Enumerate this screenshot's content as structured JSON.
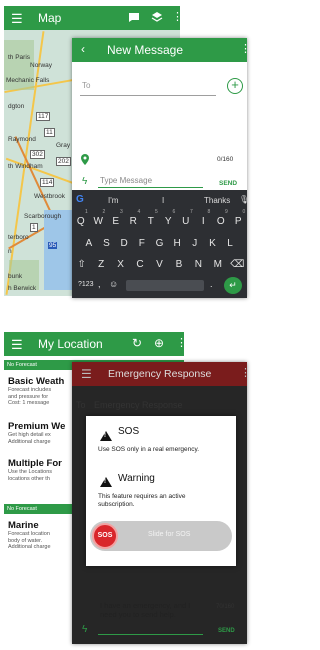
{
  "screen1": {
    "map_title": "Map",
    "map_labels": [
      "th Paris",
      "Norway",
      "Mechanic Falls",
      "dgton",
      "Raymond",
      "Gray",
      "th Windham",
      "Westbrook",
      "Scarborough",
      "terboro",
      "n",
      "bunk",
      "h Berwick"
    ],
    "road_numbers": [
      "117",
      "11",
      "302",
      "202",
      "114",
      "1",
      "95"
    ],
    "message": {
      "title": "New Message",
      "to_placeholder": "To",
      "counter": "0/160",
      "input_placeholder": "Type Message",
      "send_label": "SEND"
    },
    "keyboard": {
      "suggestions": [
        "I'm",
        "I",
        "Thanks"
      ],
      "row1": [
        "Q",
        "W",
        "E",
        "R",
        "T",
        "Y",
        "U",
        "I",
        "O",
        "P"
      ],
      "row1_hints": [
        "1",
        "2",
        "3",
        "4",
        "5",
        "6",
        "7",
        "8",
        "9",
        "0"
      ],
      "row2": [
        "A",
        "S",
        "D",
        "F",
        "G",
        "H",
        "J",
        "K",
        "L"
      ],
      "row3": [
        "Z",
        "X",
        "C",
        "V",
        "B",
        "N",
        "M"
      ],
      "sym_label": "?123",
      "comma": ",",
      "period": "."
    }
  },
  "screen2": {
    "title": "My Location",
    "section_no_forecast": "No Forecast",
    "items": [
      {
        "title": "Basic Weath",
        "desc": [
          "Forecast includes",
          "and pressure for",
          "Cost: 1 message"
        ]
      },
      {
        "title": "Premium We",
        "desc": [
          "Get high detail ex",
          "Additional charge"
        ]
      },
      {
        "title": "Multiple For",
        "desc": [
          "Use the Locations",
          "locations other th"
        ]
      }
    ],
    "section_no_forecast_2": "No Forecast",
    "marine": {
      "title": "Marine",
      "desc": [
        "Forecast location",
        "body of water.",
        "Additional charge"
      ]
    },
    "emergency": {
      "title": "Emergency Response",
      "to_value": "Emergency Response",
      "sos_heading": "SOS",
      "sos_text": "Use SOS only in a real emergency.",
      "warning_heading": "Warning",
      "warning_text": "This feature requires an active subscription.",
      "sos_button": "SOS",
      "slide_label": "Slide for SOS",
      "message_text": "I have an emergency, and I need you to send help.",
      "counter": "70/160",
      "send_label": "SEND"
    }
  },
  "colors": {
    "brand_green": "#2e9a47",
    "dark_red": "#7a1c1c",
    "sos_red": "#d9262b"
  }
}
